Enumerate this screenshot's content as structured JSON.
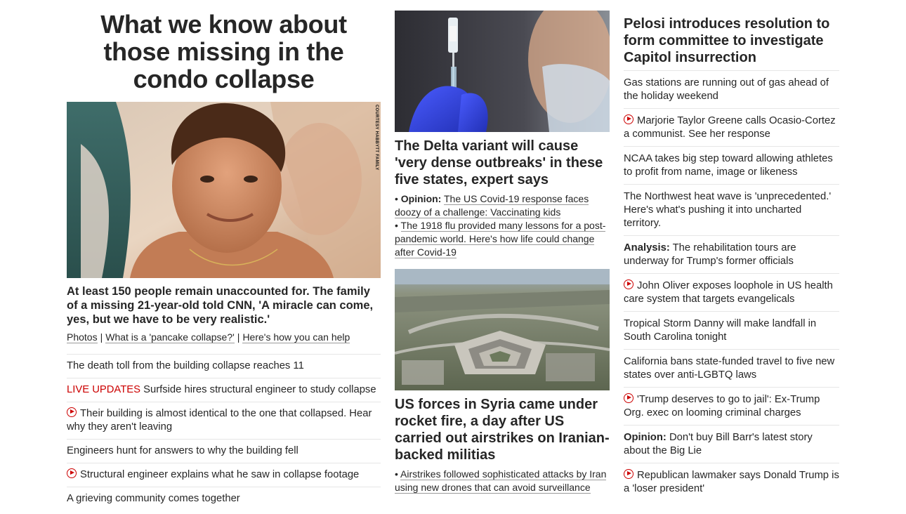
{
  "col1": {
    "title": "What we know about those missing in the condo collapse",
    "image_credit": "COURTESY HABBYTT FAMILY",
    "caption": "At least 150 people remain unaccounted for. The family of a missing 21-year-old told CNN, 'A miracle can come, yes, but we have to be very realistic.'",
    "related": [
      "Photos",
      "What is a 'pancake collapse?'",
      "Here's how you can help"
    ],
    "separator": "|",
    "items": [
      {
        "text": "The death toll from the building collapse reaches 11"
      },
      {
        "prefix": "LIVE UPDATES",
        "text": " Surfside hires structural engineer to study collapse"
      },
      {
        "video": true,
        "text": "Their building is almost identical to the one that collapsed. Hear why they aren't leaving"
      },
      {
        "text": "Engineers hunt for answers to why the building fell"
      },
      {
        "video": true,
        "text": "Structural engineer explains what he saw in collapse footage"
      },
      {
        "text": "A grieving community comes together"
      }
    ]
  },
  "col2": {
    "story1": {
      "title": "The Delta variant will cause 'very dense outbreaks' in these five states, expert says",
      "bullets": [
        {
          "bold": "Opinion:",
          "text": "The US Covid-19 response faces doozy of a challenge: Vaccinating kids"
        },
        {
          "bold": "",
          "text": "The 1918 flu provided many lessons for a post-pandemic world. Here's how life could change after Covid-19"
        }
      ]
    },
    "story2": {
      "title": "US forces in Syria came under rocket fire, a day after US carried out airstrikes on Iranian-backed militias",
      "bullets": [
        {
          "bold": "",
          "text": "Airstrikes followed sophisticated attacks by Iran using new drones that can avoid surveillance"
        }
      ]
    },
    "bullet_char": "•"
  },
  "col3": {
    "headline": "Pelosi introduces resolution to form committee to investigate Capitol insurrection",
    "items": [
      {
        "text": "Gas stations are running out of gas ahead of the holiday weekend"
      },
      {
        "video": true,
        "text": "Marjorie Taylor Greene calls Ocasio-Cortez a communist. See her response"
      },
      {
        "text": "NCAA takes big step toward allowing athletes to profit from name, image or likeness"
      },
      {
        "text": "The Northwest heat wave is 'unprecedented.' Here's what's pushing it into uncharted territory."
      },
      {
        "bold": "Analysis:",
        "text": " The rehabilitation tours are underway for Trump's former officials"
      },
      {
        "video": true,
        "text": "John Oliver exposes loophole in US health care system that targets evangelicals"
      },
      {
        "text": "Tropical Storm Danny will make landfall in South Carolina tonight"
      },
      {
        "text": "California bans state-funded travel to five new states over anti-LGBTQ laws"
      },
      {
        "video": true,
        "text": "'Trump deserves to go to jail': Ex-Trump Org. exec on looming criminal charges"
      },
      {
        "bold": "Opinion:",
        "text": " Don't buy Bill Barr's latest story about the Big Lie"
      },
      {
        "video": true,
        "text": "Republican lawmaker says Donald Trump is a 'loser president'"
      }
    ]
  },
  "colors": {
    "accent_red": "#cc0000",
    "text": "#262626",
    "divider": "#e6e6e6"
  },
  "icons": {
    "video": "play-circle-icon"
  }
}
